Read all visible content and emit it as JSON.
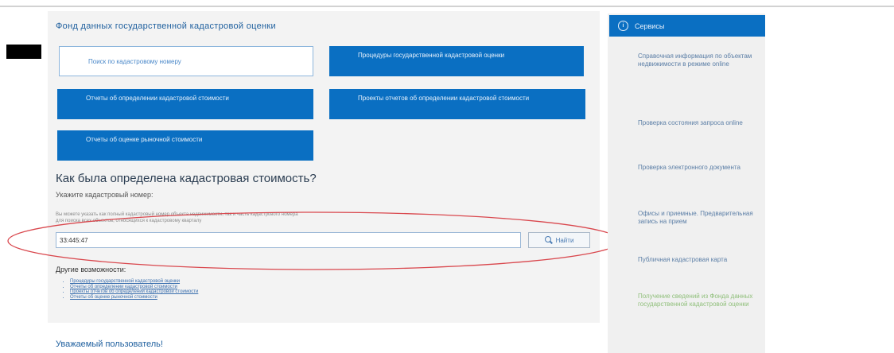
{
  "main": {
    "fund_title": "Фонд данных государственной кадастровой оценки",
    "tiles": [
      {
        "label": "Поиск по кадастровому номеру",
        "active": true
      },
      {
        "label": "Процедуры государственной кадастровой оценки"
      },
      {
        "label": "Отчеты об определении кадастровой стоимости"
      },
      {
        "label": "Проекты отчетов об определении кадастровой стоимости"
      },
      {
        "label": "Отчеты об оценке рыночной стоимости"
      }
    ],
    "question": "Как была определена кадастровая стоимость?",
    "hint": "Укажите кадастровый номер:",
    "note_line1": "Вы можете указать как полный кадастровый номер объекта недвижимости, так и часть кадастрового номера",
    "note_line2": "для поиска всех объектов, относящихся к кадастровому кварталу",
    "search_value": "33:445:47",
    "find_label": "Найти",
    "other_title": "Другие возможности:",
    "links": [
      "Процедуры государственной кадастровой оценки",
      "Отчеты об определении кадастровой стоимости",
      "Проекты отчетов об определении кадастровой стоимости",
      "Отчеты об оценке рыночной стоимости"
    ],
    "attention": "Уважаемый пользователь!"
  },
  "sidebar": {
    "header": "Сервисы",
    "items": [
      {
        "label": "Справочная информация по объектам недвижимости в режиме online"
      },
      {
        "label": "Проверка состояния запроса online"
      },
      {
        "label": "Проверка электронного документа"
      },
      {
        "label": "Офисы и приемные. Предварительная запись на прием"
      },
      {
        "label": "Публичная кадастровая карта"
      },
      {
        "label": "Получение сведений из Фонда данных государственной кадастровой оценки",
        "highlight": true
      }
    ]
  },
  "colors": {
    "accent": "#0a6fc2",
    "link": "#1e5f9e",
    "annotation_oval": "#d9474d"
  },
  "icons": {
    "find": "magnifier-icon",
    "services": "info-icon"
  }
}
